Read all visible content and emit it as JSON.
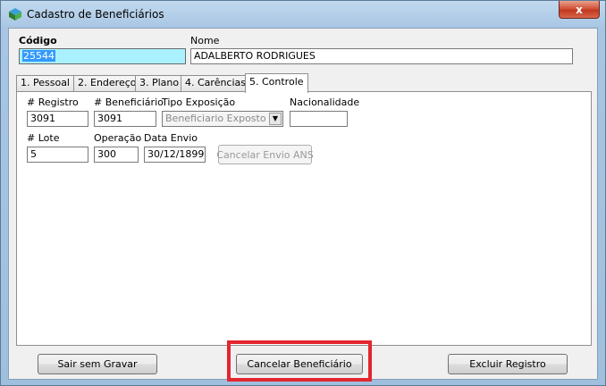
{
  "window": {
    "title": "Cadastro de Beneficiários",
    "close_label": "x"
  },
  "header": {
    "codigo_label": "Código",
    "codigo_value": "25544",
    "nome_label": "Nome",
    "nome_value": "ADALBERTO RODRIGUES"
  },
  "tabs": [
    {
      "label": "1. Pessoal"
    },
    {
      "label": "2. Endereço"
    },
    {
      "label": "3. Plano"
    },
    {
      "label": "4. Carências"
    },
    {
      "label": "5. Controle"
    }
  ],
  "controle": {
    "registro_label": "# Registro",
    "registro_value": "3091",
    "beneficiario_label": "# Beneficiário",
    "beneficiario_value": "3091",
    "tipo_exposicao_label": "Tipo Exposição",
    "tipo_exposicao_value": "Beneficiario Exposto",
    "nacionalidade_label": "Nacionalidade",
    "nacionalidade_value": "",
    "lote_label": "# Lote",
    "lote_value": "5",
    "operacao_label": "Operação",
    "operacao_value": "300",
    "data_envio_label": "Data Envio",
    "data_envio_value": "30/12/1899",
    "cancelar_envio_label": "Cancelar Envio ANS"
  },
  "footer": {
    "sair_label": "Sair sem Gravar",
    "cancelar_label": "Cancelar Beneficiário",
    "excluir_label": "Excluir Registro"
  },
  "colors": {
    "highlight": "#e3262f",
    "selection": "#3399ff",
    "codigo_bg": "#a9f1ff"
  }
}
